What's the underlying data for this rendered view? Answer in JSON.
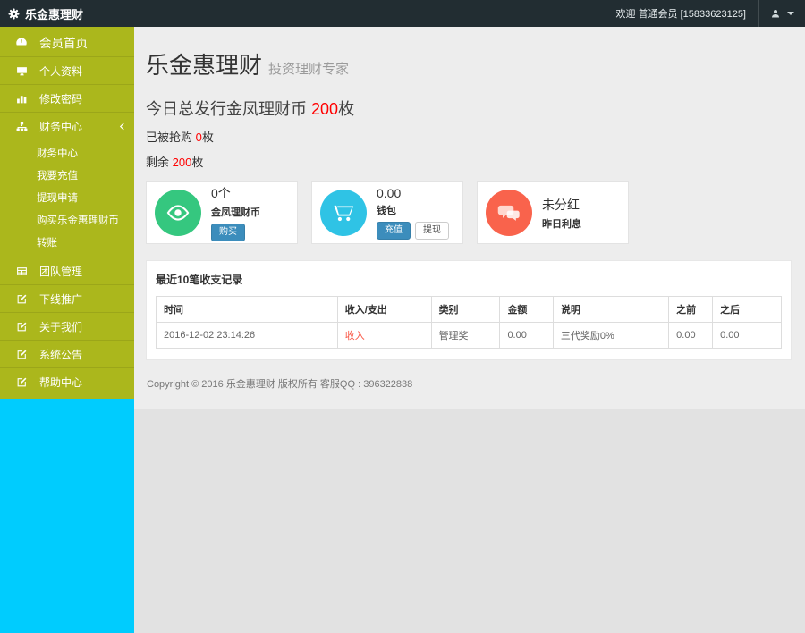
{
  "navbar": {
    "brand": "乐金惠理财",
    "welcome": "欢迎 普通会员 [15833623125]"
  },
  "sidebar": {
    "items": [
      {
        "label": "会员首页",
        "icon": "dashboard-icon"
      },
      {
        "label": "个人资料",
        "icon": "desktop-icon"
      },
      {
        "label": "修改密码",
        "icon": "bar-chart-icon"
      },
      {
        "label": "财务中心",
        "icon": "sitemap-icon"
      }
    ],
    "finance_submenu": [
      {
        "label": "财务中心"
      },
      {
        "label": "我要充值"
      },
      {
        "label": "提现申请"
      },
      {
        "label": "购买乐金惠理财币"
      },
      {
        "label": "转账"
      }
    ],
    "items_bottom": [
      {
        "label": "团队管理",
        "icon": "table-icon"
      },
      {
        "label": "下线推广",
        "icon": "edit-icon"
      },
      {
        "label": "关于我们",
        "icon": "edit-icon"
      },
      {
        "label": "系统公告",
        "icon": "edit-icon"
      },
      {
        "label": "帮助中心",
        "icon": "edit-icon"
      }
    ]
  },
  "main": {
    "title": "乐金惠理财",
    "subtitle": "投资理财专家",
    "stats": {
      "issue": {
        "label": "今日总发行金凤理财币",
        "value": "200",
        "unit": "枚"
      },
      "sold": {
        "label": "已被抢购",
        "value": "0",
        "unit": "枚"
      },
      "remain": {
        "label": "剩余",
        "value": "200",
        "unit": "枚"
      }
    },
    "cards": [
      {
        "value": "0个",
        "label": "金凤理财币",
        "icon": "eye-icon",
        "buttons": [
          "购买"
        ]
      },
      {
        "value": "0.00",
        "label": "钱包",
        "icon": "cart-icon",
        "buttons": [
          "充值",
          "提现"
        ]
      },
      {
        "value": "未分红",
        "label": "昨日利息",
        "icon": "comments-icon",
        "buttons": []
      }
    ],
    "table": {
      "title": "最近10笔收支记录",
      "headers": [
        "时间",
        "收入/支出",
        "类别",
        "金额",
        "说明",
        "之前",
        "之后"
      ],
      "rows": [
        [
          "2016-12-02 23:14:26",
          "收入",
          "管理奖",
          "0.00",
          "三代奖励0%",
          "0.00",
          "0.00"
        ]
      ]
    },
    "footer": "Copyright © 2016 乐金惠理财 版权所有 客服QQ : 396322838"
  },
  "colors": {
    "navbar_bg": "#222d32",
    "sidebar_menu": "#abb71c",
    "sidebar_lower": "#00ccfe",
    "primary_button": "#3c8dbc",
    "accent_red": "#ff0000",
    "card_green": "#35c77f",
    "card_cyan": "#2fc3e5",
    "card_red": "#f9634c"
  }
}
